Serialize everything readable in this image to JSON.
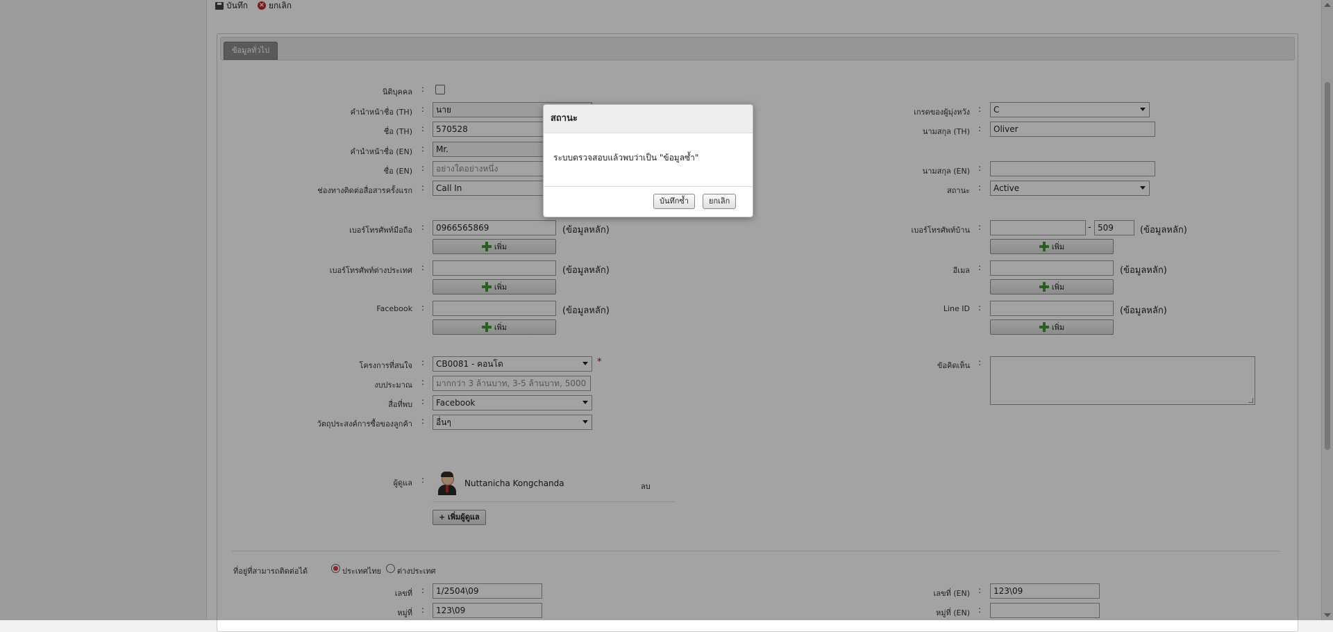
{
  "toolbar": {
    "save": "บันทึก",
    "cancel": "ยกเลิก"
  },
  "tabs": {
    "general": "ข้อมูลทั่วไป"
  },
  "form": {
    "juristic": {
      "label": "นิติบุคคล",
      "checked": false
    },
    "prefix_th": {
      "label": "คำนำหน้าชื่อ (TH)",
      "value": "นาย"
    },
    "name_th": {
      "label": "ชื่อ (TH)",
      "value": "570528"
    },
    "prefix_en": {
      "label": "คำนำหน้าชื่อ (EN)",
      "value": "Mr."
    },
    "name_en": {
      "label": "ชื่อ (EN)",
      "placeholder": "อย่างใดอย่างหนึ่ง"
    },
    "first_channel": {
      "label": "ช่องทางติดต่อสื่อสารครั้งแรก",
      "value": "Call In"
    },
    "grade": {
      "label": "เกรดของผู้มุ่งหวัง",
      "value": "C"
    },
    "surname_th": {
      "label": "นามสกุล (TH)",
      "value": "Oliver"
    },
    "surname_en": {
      "label": "นามสกุล (EN)",
      "value": ""
    },
    "status": {
      "label": "สถานะ",
      "value": "Active"
    },
    "mobile": {
      "label": "เบอร์โทรศัพท์มือถือ",
      "value": "0966565869",
      "note": "(ข้อมูลหลัก)",
      "add": "เพิ่ม"
    },
    "home_phone": {
      "label": "เบอร์โทรศัพท์บ้าน",
      "value": "",
      "dash": "-",
      "ext": "509",
      "note": "(ข้อมูลหลัก)",
      "add": "เพิ่ม"
    },
    "foreign_phone": {
      "label": "เบอร์โทรศัพท์ต่างประเทศ",
      "value": "",
      "note": "(ข้อมูลหลัก)",
      "add": "เพิ่ม"
    },
    "email": {
      "label": "อีเมล",
      "value": "",
      "note": "(ข้อมูลหลัก)",
      "add": "เพิ่ม"
    },
    "facebook": {
      "label": "Facebook",
      "value": "",
      "note": "(ข้อมูลหลัก)",
      "add": "เพิ่ม"
    },
    "line_id": {
      "label": "Line ID",
      "value": "",
      "note": "(ข้อมูลหลัก)",
      "add": "เพิ่ม"
    },
    "project": {
      "label": "โครงการที่สนใจ",
      "value": "CB0081 - คอนโด",
      "required": "*"
    },
    "budget": {
      "label": "งบประมาณ",
      "placeholder": "มากกว่า 3 ล้านบาท, 3-5 ล้านบาท, 5000"
    },
    "media": {
      "label": "สื่อที่พบ",
      "value": "Facebook"
    },
    "purpose": {
      "label": "วัตถุประสงค์การซื้อของลูกค้า",
      "value": "อื่นๆ"
    },
    "comment": {
      "label": "ข้อคิดเห็น",
      "value": ""
    },
    "caretaker": {
      "label": "ผู้ดูแล",
      "name": "Nuttanicha Kongchanda",
      "remove": "ลบ",
      "add": "เพิ่มผู้ดูแล"
    },
    "address": {
      "label": "ที่อยู่ที่สามารถติดต่อได้",
      "thai": "ประเทศไทย",
      "foreign": "ต่างประเทศ",
      "selected": "thai",
      "house_no": {
        "label": "เลขที่",
        "value": "1/2504\\09"
      },
      "house_no_en": {
        "label": "เลขที่ (EN)",
        "value": "123\\09"
      },
      "moo": {
        "label": "หมู่ที่",
        "value": "123\\09"
      },
      "moo_en": {
        "label": "หมู่ที่ (EN)",
        "value": ""
      }
    }
  },
  "dialog": {
    "title": "สถานะ",
    "message": "ระบบตรวจสอบแล้วพบว่าเป็น \"ข้อมูลซ้ำ\"",
    "save_dup": "บันทึกซ้ำ",
    "cancel": "ยกเลิก"
  }
}
